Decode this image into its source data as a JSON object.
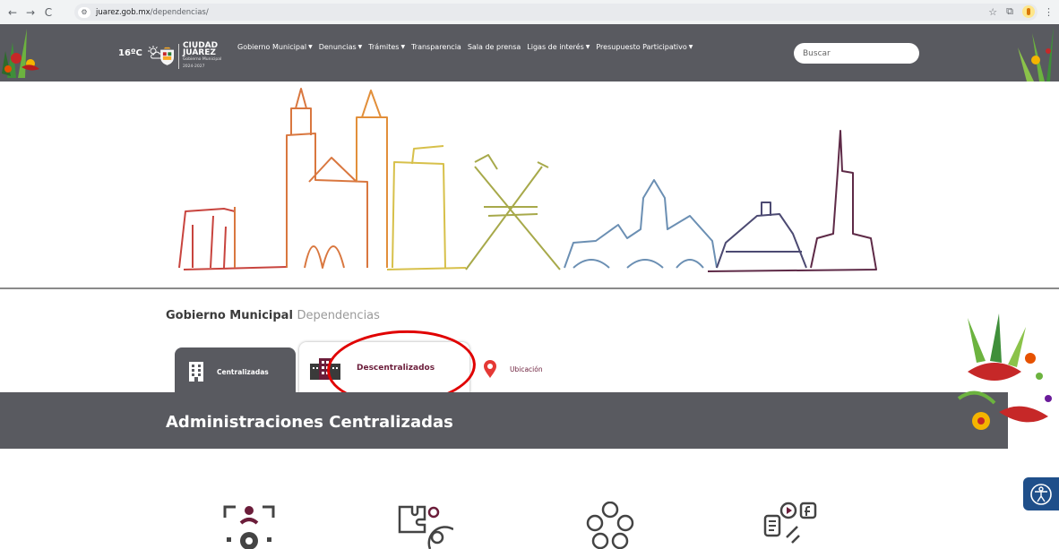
{
  "browser": {
    "url_host": "juarez.gob.mx",
    "url_path": "/dependencias/",
    "back_icon": "arrow-left-icon",
    "forward_icon": "arrow-right-icon",
    "reload_icon": "reload-icon"
  },
  "header": {
    "temperature": "16ºC",
    "logo_text": {
      "top": "ciudad",
      "city": "CIUDAD",
      "name": "JUÁREZ",
      "admin": "Gobierno Municipal 2024-2027"
    },
    "menu": [
      {
        "label": "Gobierno Municipal",
        "has_dropdown": true
      },
      {
        "label": "Denuncias",
        "has_dropdown": true
      },
      {
        "label": "Trámites",
        "has_dropdown": true
      },
      {
        "label": "Transparencia",
        "has_dropdown": false
      },
      {
        "label": "Sala de prensa",
        "has_dropdown": false
      },
      {
        "label": "Ligas de interés",
        "has_dropdown": true
      },
      {
        "label": "Presupuesto Participativo",
        "has_dropdown": true
      }
    ],
    "search_placeholder": "Buscar",
    "background": "#595a60"
  },
  "breadcrumb": {
    "parent": "Gobierno Municipal",
    "current": "Dependencias"
  },
  "tabs": [
    {
      "label": "Centralizadas",
      "icon": "building-icon",
      "active": true
    },
    {
      "label": "Descentralizados",
      "icon": "office-building-icon",
      "active": false,
      "highlighted": true
    },
    {
      "label": "Ubicación",
      "icon": "map-pin-icon",
      "active": false
    }
  ],
  "section": {
    "title": "Administraciones Centralizadas"
  },
  "colors": {
    "brand_gray": "#595a60",
    "brand_maroon": "#6b1d3a",
    "highlight_red": "#e00000"
  }
}
